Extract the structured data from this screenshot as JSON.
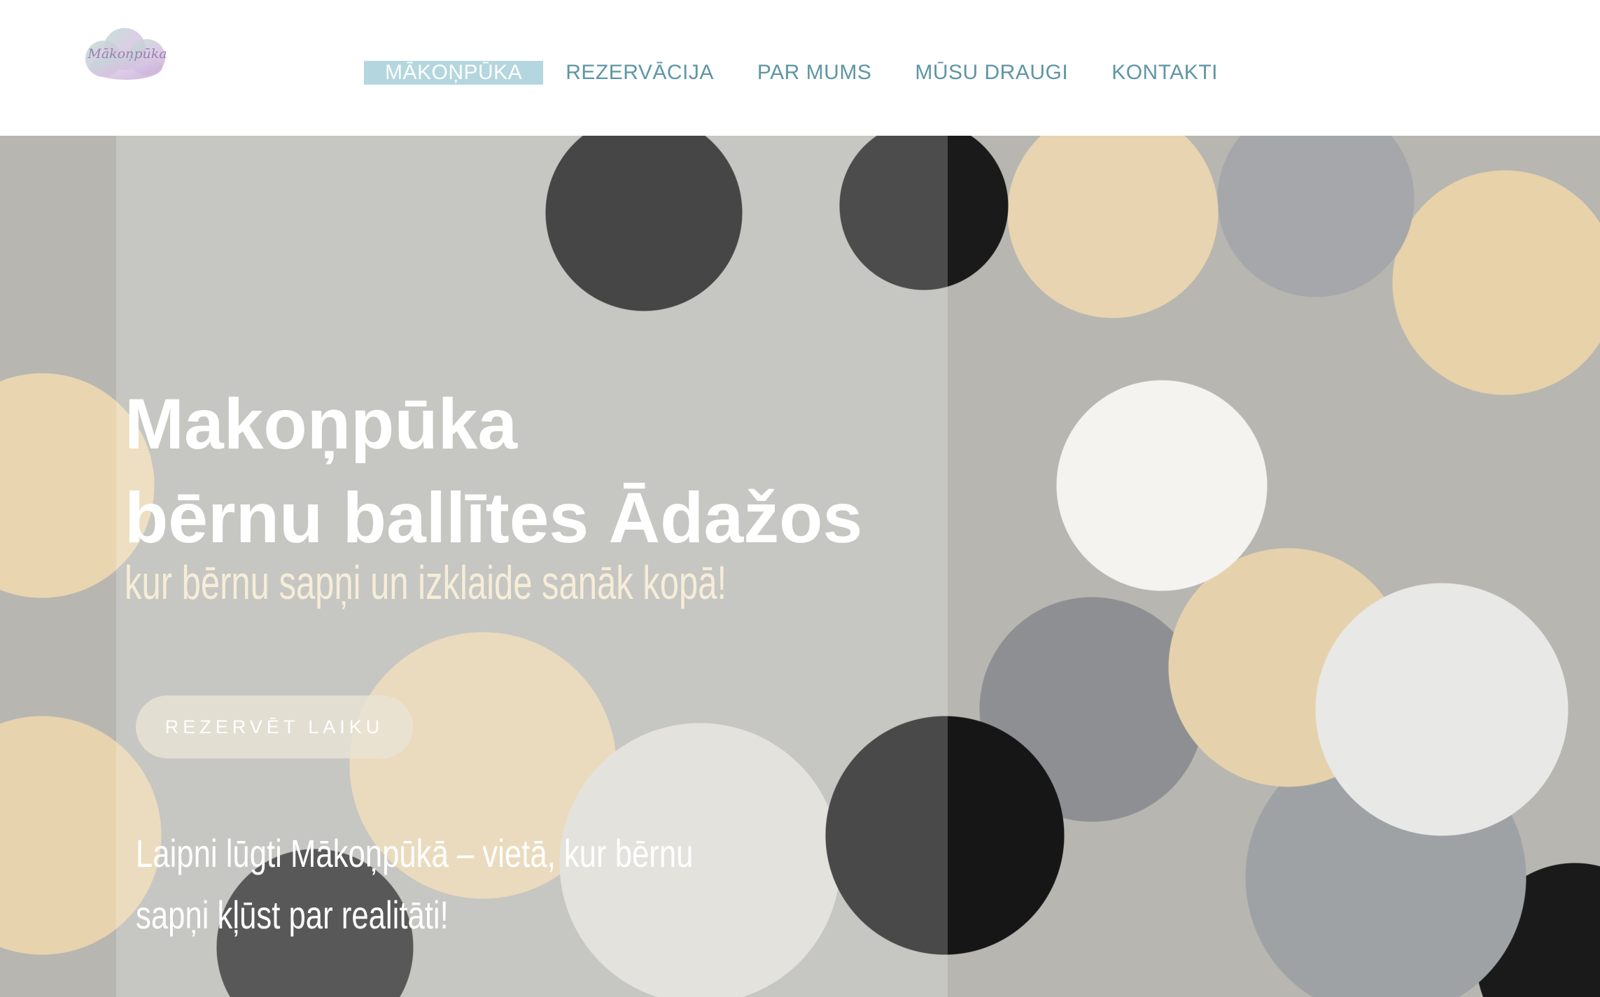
{
  "header": {
    "logo_text": "Mākoņpūka",
    "nav": [
      {
        "label": "MĀKOŅPŪKA",
        "active": true
      },
      {
        "label": "REZERVĀCIJA",
        "active": false
      },
      {
        "label": "PAR MUMS",
        "active": false
      },
      {
        "label": "MŪSU DRAUGI",
        "active": false
      },
      {
        "label": "KONTAKTI",
        "active": false
      }
    ]
  },
  "hero": {
    "title_line1": "Makoņpūka",
    "title_line2": "bērnu ballītes Ādažos",
    "subtitle": "kur bērnu sapņi un izklaide sanāk kopā!",
    "cta_label": "REZERVĒT LAIKU",
    "welcome": "Laipni lūgti Mākoņpūkā – vietā, kur bērnu sapņi kļūst par realitāti!"
  },
  "colors": {
    "nav_text": "#5e96a4",
    "nav_active_bg": "#b4d6de",
    "subtitle": "#f6edd9",
    "cta_bg": "#e9e4d6"
  }
}
